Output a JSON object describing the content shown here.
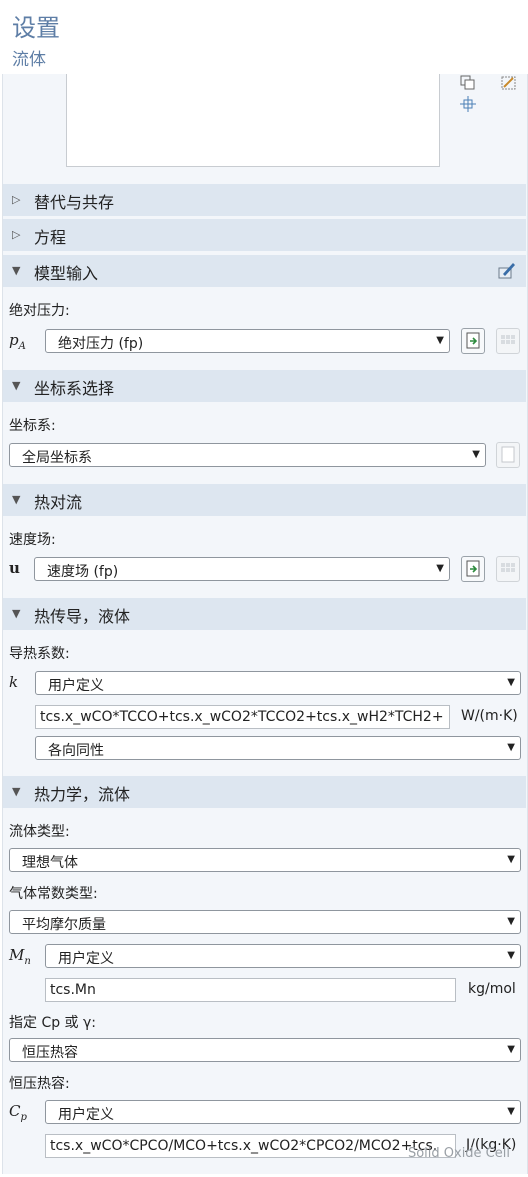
{
  "header": {
    "title": "设置",
    "subtitle": "流体"
  },
  "sections": {
    "substitution": "替代与共存",
    "equation": "方程",
    "model_input": "模型输入",
    "coordinate": "坐标系选择",
    "convection": "热对流",
    "conduction": "热传导，液体",
    "thermo": "热力学，流体"
  },
  "model_input": {
    "pressure_label": "绝对压力:",
    "pressure_symbol": "pA",
    "pressure_value": "绝对压力 (fp)"
  },
  "coordinate": {
    "label": "坐标系:",
    "value": "全局坐标系"
  },
  "convection": {
    "label": "速度场:",
    "symbol": "u",
    "value": "速度场 (fp)"
  },
  "conduction": {
    "label": "导热系数:",
    "symbol": "k",
    "mode": "用户定义",
    "expression": "tcs.x_wCO*TCCO+tcs.x_wCO2*TCCO2+tcs.x_wH2*TCH2+",
    "unit": "W/(m·K)",
    "iso": "各向同性"
  },
  "thermo": {
    "fluid_type_label": "流体类型:",
    "fluid_type_value": "理想气体",
    "gas_const_label": "气体常数类型:",
    "gas_const_value": "平均摩尔质量",
    "mn_symbol": "Mn",
    "mn_mode": "用户定义",
    "mn_expression": "tcs.Mn",
    "mn_unit": "kg/mol",
    "cp_or_gamma_label": "指定 Cp 或 γ:",
    "cp_or_gamma_value": "恒压热容",
    "cp_label": "恒压热容:",
    "cp_symbol": "Cp",
    "cp_mode": "用户定义",
    "cp_expression": "tcs.x_wCO*CPCO/MCO+tcs.x_wCO2*CPCO2/MCO2+tcs.",
    "cp_unit": "J/(kg·K)"
  },
  "watermark": "Solid Oxide Cell",
  "icons": [
    "copy-icon",
    "clear-icon",
    "move-icon",
    "edit-icon",
    "link-variable-icon",
    "plot-grid-icon",
    "expand-icon",
    "collapse-icon",
    "dropdown-arrow-icon"
  ]
}
